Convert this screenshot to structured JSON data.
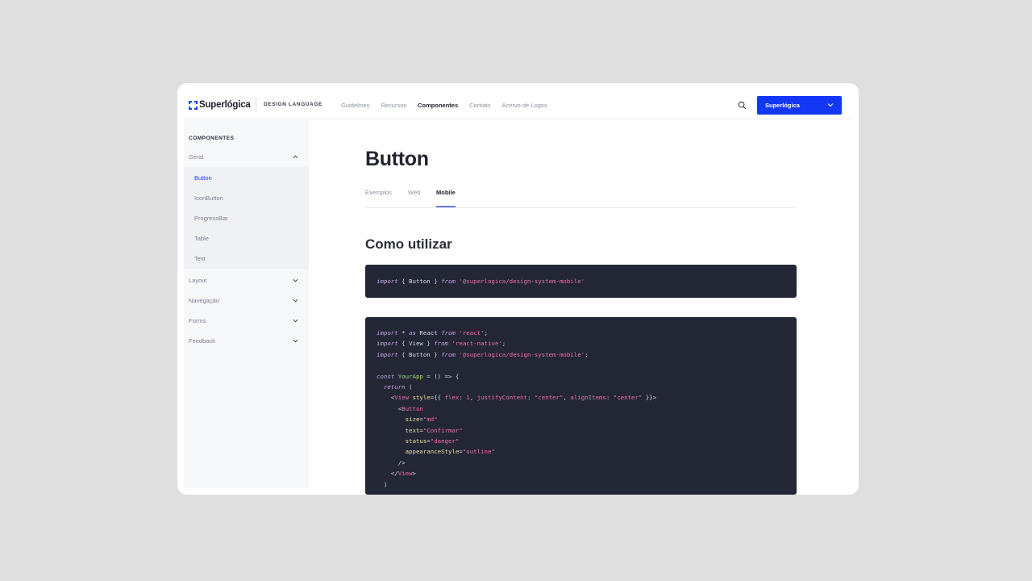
{
  "header": {
    "logo_text": "Superlógica",
    "logo_subtitle": "DESIGN LANGUAGE",
    "nav": [
      "Guidelines",
      "Recursos",
      "Componentes",
      "Contato",
      "Acervo de Logos"
    ],
    "active_nav": "Componentes",
    "brand_select": "Superlógica"
  },
  "sidebar": {
    "title": "COMPONENTES",
    "groups": [
      "Geral",
      "Layout",
      "Navegação",
      "Forms",
      "Feedback"
    ],
    "items": [
      "Button",
      "IconButton",
      "ProgressBar",
      "Table",
      "Text"
    ],
    "active_item": "Button"
  },
  "main": {
    "page_title": "Button",
    "tabs": [
      "Exemplos",
      "Web",
      "Mobile"
    ],
    "active_tab": "Mobile",
    "section_title": "Como utilizar"
  },
  "code_import": [
    {
      "t": "import",
      "c": "kw"
    },
    {
      "t": " { Button } ",
      "c": "plain"
    },
    {
      "t": "from",
      "c": "kw"
    },
    {
      "t": " '@superlogica/design-system-mobile'",
      "c": "str"
    }
  ],
  "code_example": [
    [
      {
        "t": "import",
        "c": "kw"
      },
      {
        "t": " * ",
        "c": "plain"
      },
      {
        "t": "as",
        "c": "kw"
      },
      {
        "t": " React ",
        "c": "plain"
      },
      {
        "t": "from",
        "c": "kw"
      },
      {
        "t": " 'react'",
        "c": "str"
      },
      {
        "t": ";",
        "c": "plain"
      }
    ],
    [
      {
        "t": "import",
        "c": "kw"
      },
      {
        "t": " { View } ",
        "c": "plain"
      },
      {
        "t": "from",
        "c": "kw"
      },
      {
        "t": " 'react-native'",
        "c": "str"
      },
      {
        "t": ";",
        "c": "plain"
      }
    ],
    [
      {
        "t": "import",
        "c": "kw"
      },
      {
        "t": " { Button } ",
        "c": "plain"
      },
      {
        "t": "from",
        "c": "kw"
      },
      {
        "t": " '@superlogica/design-system-mobile'",
        "c": "str"
      },
      {
        "t": ";",
        "c": "plain"
      }
    ],
    [],
    [
      {
        "t": "const",
        "c": "kw"
      },
      {
        "t": " YourApp",
        "c": "fn"
      },
      {
        "t": " = () => {",
        "c": "plain"
      }
    ],
    [
      {
        "t": "  ",
        "c": "plain"
      },
      {
        "t": "return",
        "c": "kw"
      },
      {
        "t": " (",
        "c": "plain"
      }
    ],
    [
      {
        "t": "    <",
        "c": "plain"
      },
      {
        "t": "View",
        "c": "tag"
      },
      {
        "t": " style",
        "c": "attr"
      },
      {
        "t": "={{ ",
        "c": "plain"
      },
      {
        "t": "flex",
        "c": "str"
      },
      {
        "t": ": ",
        "c": "plain"
      },
      {
        "t": "1",
        "c": "str"
      },
      {
        "t": ", ",
        "c": "plain"
      },
      {
        "t": "justifyContent",
        "c": "str"
      },
      {
        "t": ": ",
        "c": "plain"
      },
      {
        "t": "\"center\"",
        "c": "str"
      },
      {
        "t": ", ",
        "c": "plain"
      },
      {
        "t": "alignItems",
        "c": "str"
      },
      {
        "t": ": ",
        "c": "plain"
      },
      {
        "t": "\"center\"",
        "c": "str"
      },
      {
        "t": " }}>",
        "c": "plain"
      }
    ],
    [
      {
        "t": "      <",
        "c": "plain"
      },
      {
        "t": "Button",
        "c": "tag"
      }
    ],
    [
      {
        "t": "        ",
        "c": "plain"
      },
      {
        "t": "size",
        "c": "attr"
      },
      {
        "t": "=",
        "c": "plain"
      },
      {
        "t": "\"md\"",
        "c": "str"
      }
    ],
    [
      {
        "t": "        ",
        "c": "plain"
      },
      {
        "t": "text",
        "c": "attr"
      },
      {
        "t": "=",
        "c": "plain"
      },
      {
        "t": "\"Confirmar\"",
        "c": "str"
      }
    ],
    [
      {
        "t": "        ",
        "c": "plain"
      },
      {
        "t": "status",
        "c": "attr"
      },
      {
        "t": "=",
        "c": "plain"
      },
      {
        "t": "\"danger\"",
        "c": "str"
      }
    ],
    [
      {
        "t": "        ",
        "c": "plain"
      },
      {
        "t": "appearanceStyle",
        "c": "attr"
      },
      {
        "t": "=",
        "c": "plain"
      },
      {
        "t": "\"outline\"",
        "c": "str"
      }
    ],
    [
      {
        "t": "      />",
        "c": "plain"
      }
    ],
    [
      {
        "t": "    </",
        "c": "plain"
      },
      {
        "t": "View",
        "c": "tag"
      },
      {
        "t": ">",
        "c": "plain"
      }
    ],
    [
      {
        "t": "  )",
        "c": "plain"
      }
    ]
  ],
  "colors": {
    "accent": "#1437f5",
    "code_bg": "#232635"
  }
}
